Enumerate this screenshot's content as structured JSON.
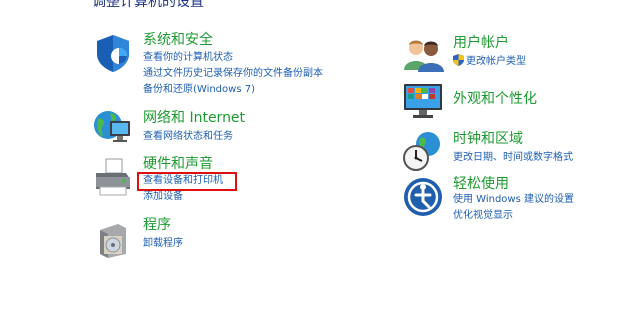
{
  "top_clipped_text": "调整计算机的设置",
  "categories": {
    "system_security": {
      "title": "系统和安全",
      "links": [
        "查看你的计算机状态",
        "通过文件历史记录保存你的文件备份副本",
        "备份和还原(Windows 7)"
      ]
    },
    "network": {
      "title": "网络和 Internet",
      "links": [
        "查看网络状态和任务"
      ]
    },
    "hardware": {
      "title": "硬件和声音",
      "links": [
        "查看设备和打印机",
        "添加设备"
      ]
    },
    "programs": {
      "title": "程序",
      "links": [
        "卸载程序"
      ]
    },
    "user_accounts": {
      "title": "用户帐户",
      "links": [
        "更改帐户类型"
      ]
    },
    "appearance": {
      "title": "外观和个性化",
      "links": []
    },
    "clock_region": {
      "title": "时钟和区域",
      "links": [
        "更改日期、时间或数字格式"
      ]
    },
    "ease_of_access": {
      "title": "轻松使用",
      "links": [
        "使用 Windows 建议的设置",
        "优化视觉显示"
      ]
    }
  },
  "colors": {
    "title_green": "#1e9b32",
    "link_blue": "#1e5fb4",
    "highlight_red": "#e01010"
  },
  "icons": {
    "system_security": "shield-icon",
    "network": "globe-monitor-icon",
    "hardware": "printer-icon",
    "programs": "disc-box-icon",
    "user_accounts": "users-icon",
    "appearance": "monitor-palette-icon",
    "clock_region": "clock-globe-icon",
    "ease_of_access": "accessibility-icon"
  }
}
